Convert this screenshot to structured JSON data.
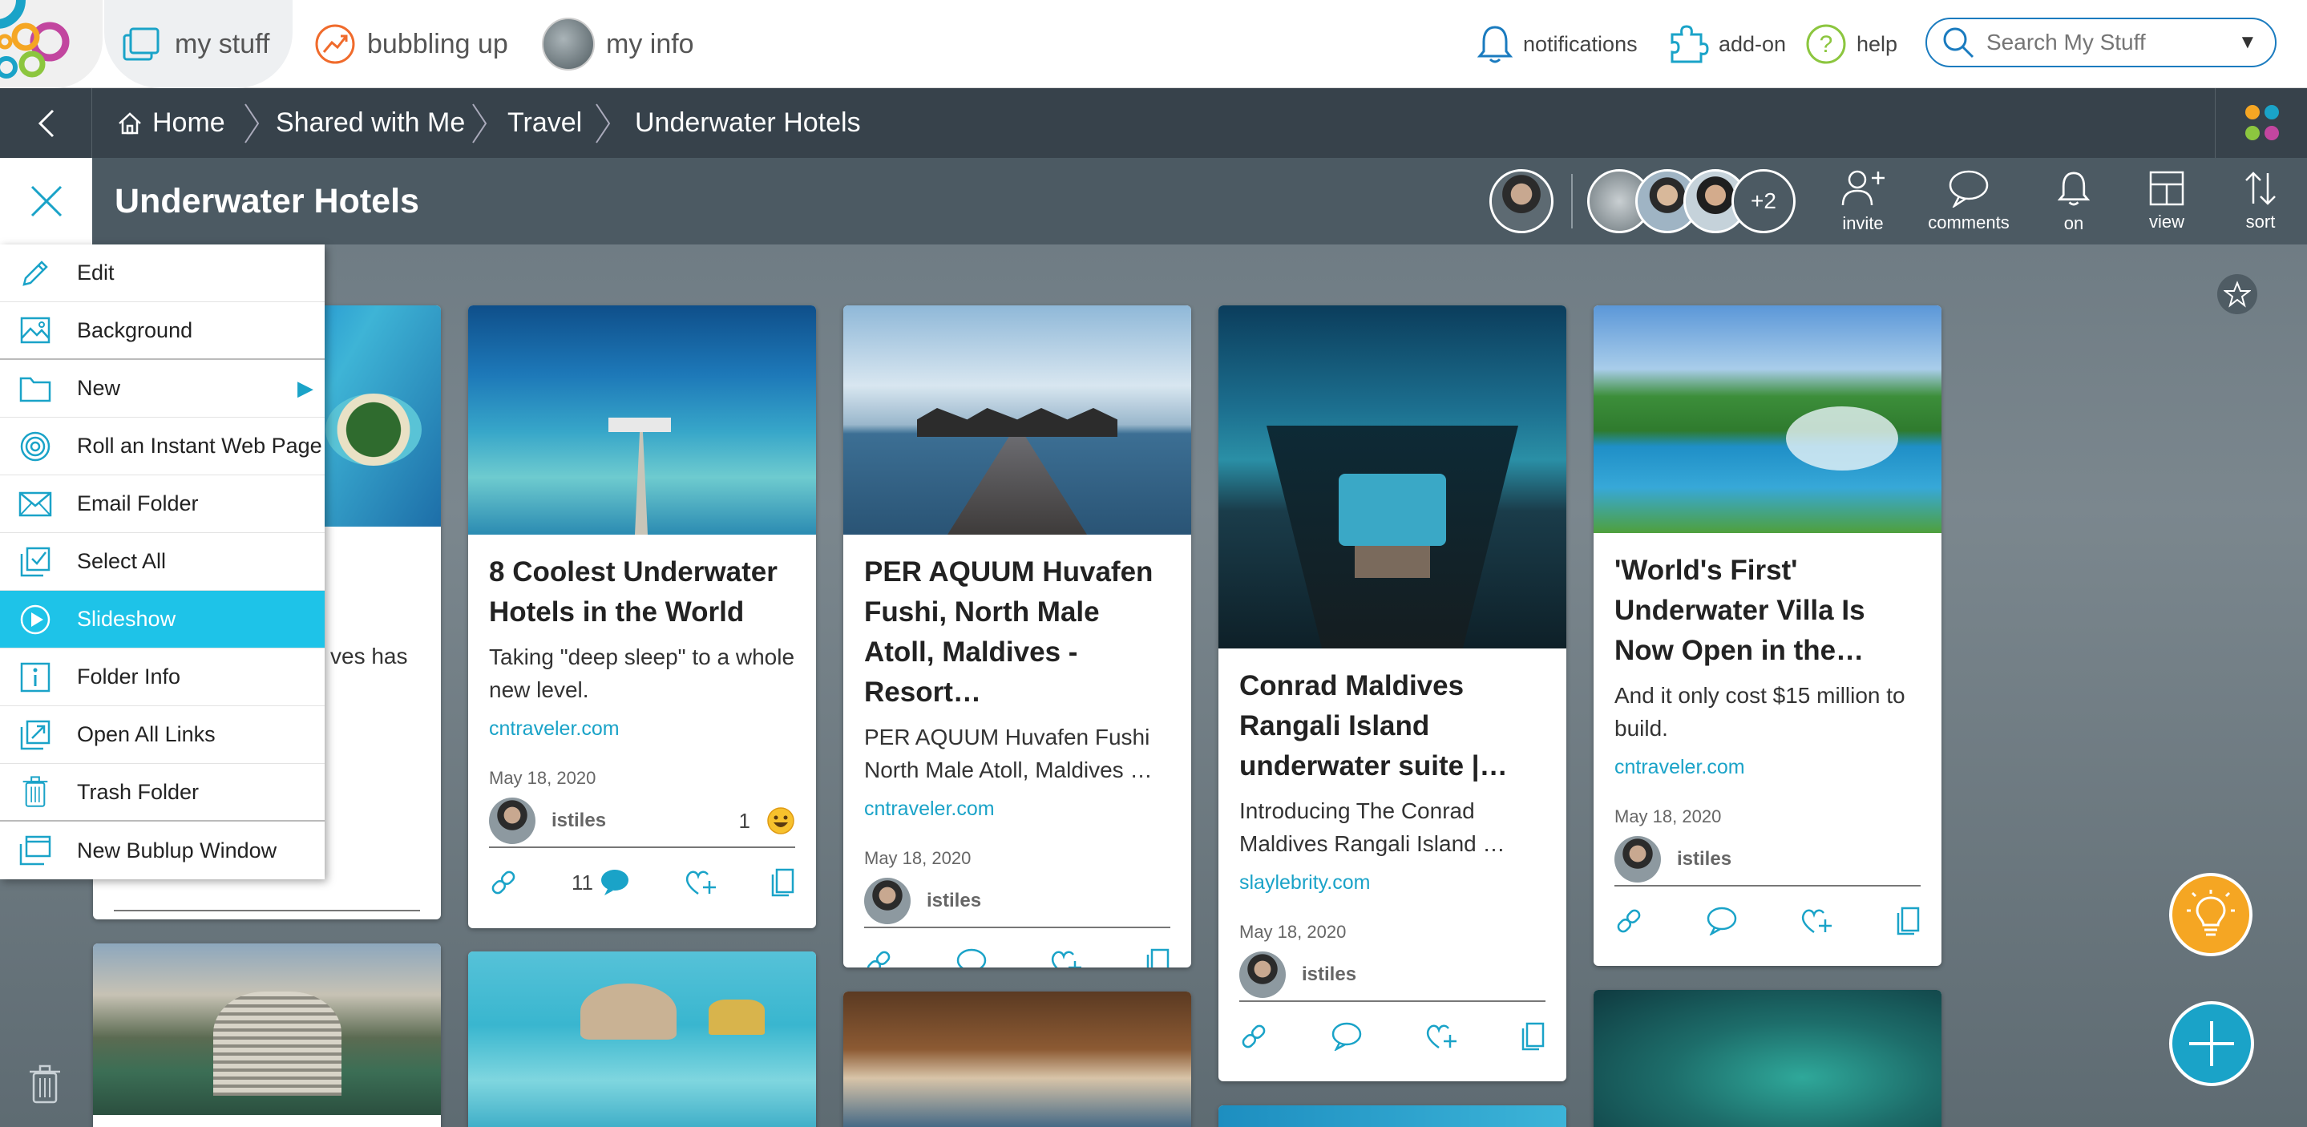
{
  "nav": {
    "my_stuff": "my stuff",
    "bubbling_up": "bubbling up",
    "my_info": "my info",
    "notifications": "notifications",
    "addon": "add-on",
    "help": "help",
    "search_placeholder": "Search My Stuff"
  },
  "breadcrumb": [
    "Home",
    "Shared with Me",
    "Travel",
    "Underwater Hotels"
  ],
  "folder": {
    "title": "Underwater Hotels",
    "extra_members": "+2",
    "invite": "invite",
    "comments": "comments",
    "notify": "on",
    "view": "view",
    "sort": "sort"
  },
  "menu": [
    "Edit",
    "Background",
    "New",
    "Roll an Instant Web Page",
    "Email Folder",
    "Select All",
    "Slideshow",
    "Folder Info",
    "Open All Links",
    "Trash Folder",
    "New Bublup Window"
  ],
  "menu_highlight": "Slideshow",
  "cards": [
    {
      "partial_text": "ves has"
    },
    {
      "title": "8 Coolest Underwater Hotels in the World",
      "desc": "Taking \"deep sleep\" to a whole new level.",
      "source": "cntraveler.com",
      "date": "May 18, 2020",
      "owner": "istiles",
      "reactions": "1",
      "comments": "11"
    },
    {
      "title": "PER AQUUM Huvafen Fushi, North Male Atoll, Maldives - Resort…",
      "desc": "PER AQUUM Huvafen Fushi North Male Atoll, Maldives …",
      "source": "cntraveler.com",
      "date": "May 18, 2020",
      "owner": "istiles"
    },
    {
      "title": "Conrad Maldives Rangali Island underwater suite |…",
      "desc": "Introducing The Conrad Maldives Rangali Island …",
      "source": "slaylebrity.com",
      "date": "May 18, 2020",
      "owner": "istiles"
    },
    {
      "title": "'World's First' Underwater Villa Is Now Open in the…",
      "desc": "And it only cost $15 million to build.",
      "source": "cntraveler.com",
      "date": "May 18, 2020",
      "owner": "istiles"
    }
  ],
  "colors": {
    "accent": "#1ec3e8",
    "link": "#1aa3c8",
    "header": "#37424b",
    "fab_tip": "#f5a623",
    "fab_add": "#1aa3c8"
  }
}
